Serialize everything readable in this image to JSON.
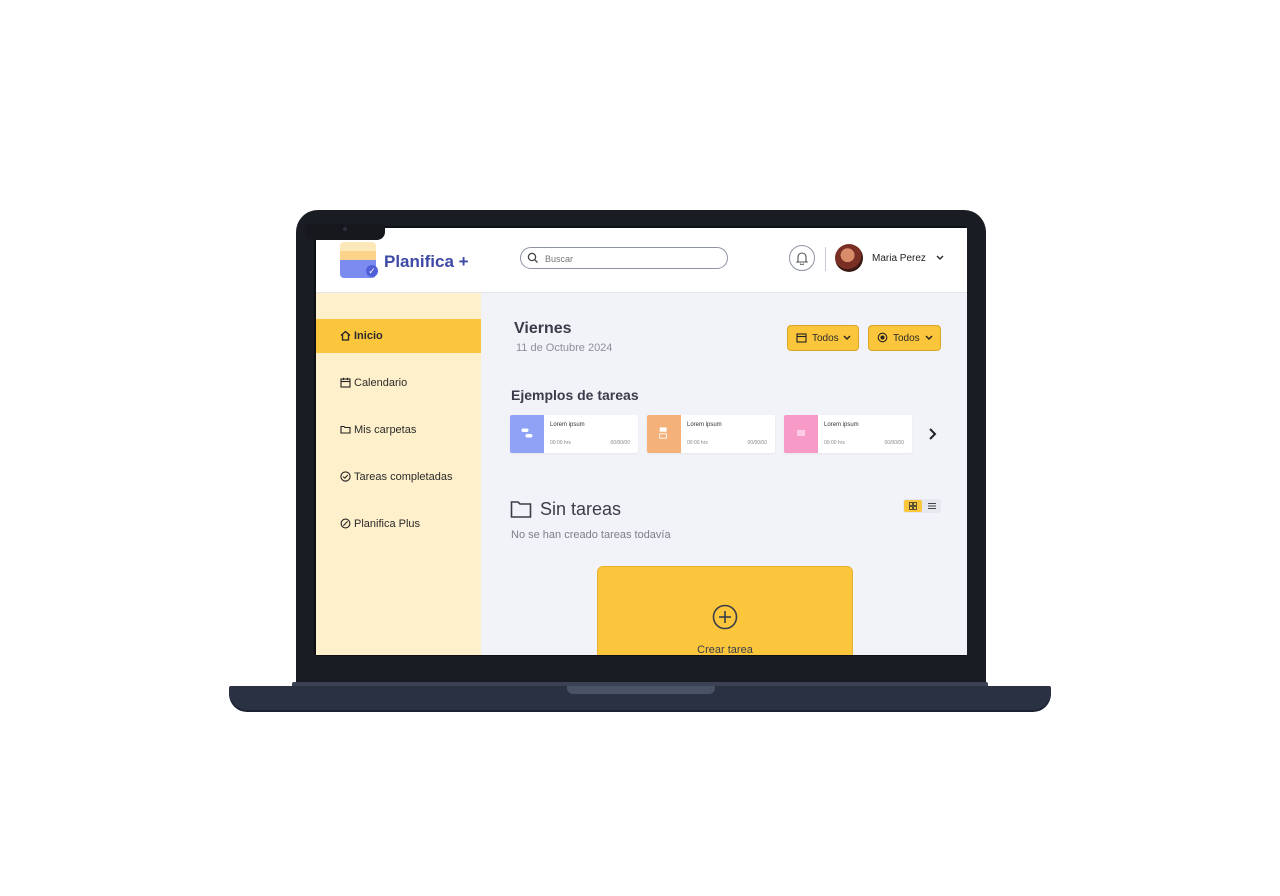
{
  "app": {
    "brand": "Planifica +"
  },
  "search": {
    "placeholder": "Buscar"
  },
  "user": {
    "name": "Maria Perez"
  },
  "sidebar": {
    "items": [
      {
        "label": "Inicio",
        "icon": "home-icon",
        "active": true
      },
      {
        "label": "Calendario",
        "icon": "calendar-icon",
        "active": false
      },
      {
        "label": "Mis carpetas",
        "icon": "folder-icon",
        "active": false
      },
      {
        "label": "Tareas completadas",
        "icon": "check-circle-icon",
        "active": false
      },
      {
        "label": "Planifica Plus",
        "icon": "badge-check-icon",
        "active": false
      }
    ]
  },
  "header": {
    "day": "Viernes",
    "date": "11 de Octubre 2024"
  },
  "filters": [
    {
      "label": "Todos",
      "icon": "calendar-icon"
    },
    {
      "label": "Todos",
      "icon": "radio-icon"
    }
  ],
  "examples": {
    "title": "Ejemplos de tareas",
    "cards": [
      {
        "title": "Lorem ipsum",
        "time": "00:00 hrs",
        "date": "00/00/00",
        "color": "#8fa2f5",
        "icon": "toggle-icon"
      },
      {
        "title": "Lorem ipsum",
        "time": "00:00 hrs",
        "date": "00/00/00",
        "color": "#f4b27a",
        "icon": "checkbox-icon"
      },
      {
        "title": "Lorem ipsum",
        "time": "00:00 hrs",
        "date": "00/00/00",
        "color": "#f79ac8",
        "icon": "lines-icon"
      }
    ]
  },
  "empty": {
    "title": "Sin tareas",
    "subtitle": "No se han creado tareas todavía"
  },
  "create": {
    "label": "Crear tarea"
  },
  "colors": {
    "accent": "#fbc63c",
    "sidebar": "#fff0cc",
    "brand": "#3e4aa6"
  }
}
